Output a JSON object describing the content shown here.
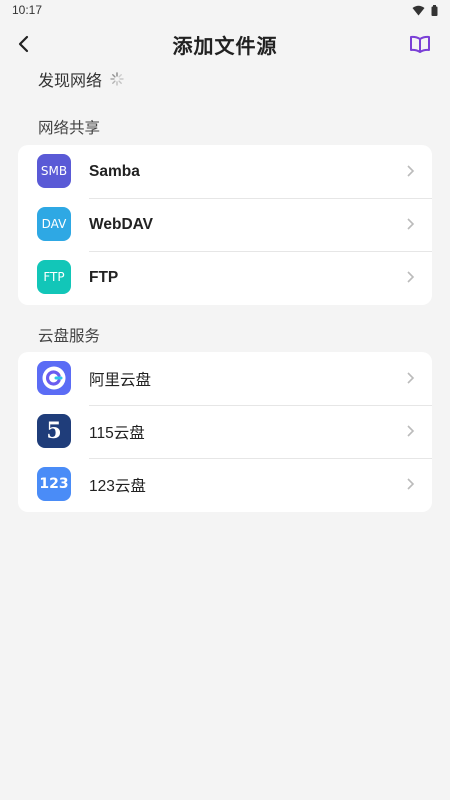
{
  "status_bar": {
    "time": "10:17"
  },
  "app_bar": {
    "title": "添加文件源"
  },
  "discover": {
    "label": "发现网络"
  },
  "network_share": {
    "header": "网络共享",
    "items": [
      {
        "label": "Samba",
        "icon_text": "SMB",
        "icon_color": "#5a5ad6"
      },
      {
        "label": "WebDAV",
        "icon_text": "DAV",
        "icon_color": "#2ea8e4"
      },
      {
        "label": "FTP",
        "icon_text": "FTP",
        "icon_color": "#12c6b8"
      }
    ]
  },
  "cloud_service": {
    "header": "云盘服务",
    "items": [
      {
        "label": "阿里云盘",
        "icon_color": "#5b6cf5"
      },
      {
        "label": "115云盘",
        "icon_text": "5",
        "icon_color": "#1f3d7a"
      },
      {
        "label": "123云盘",
        "icon_text": "123",
        "icon_color": "#4a8cf7"
      }
    ]
  },
  "colors": {
    "accent": "#7a3fd6",
    "background": "#f4f4f4",
    "card": "#ffffff"
  }
}
